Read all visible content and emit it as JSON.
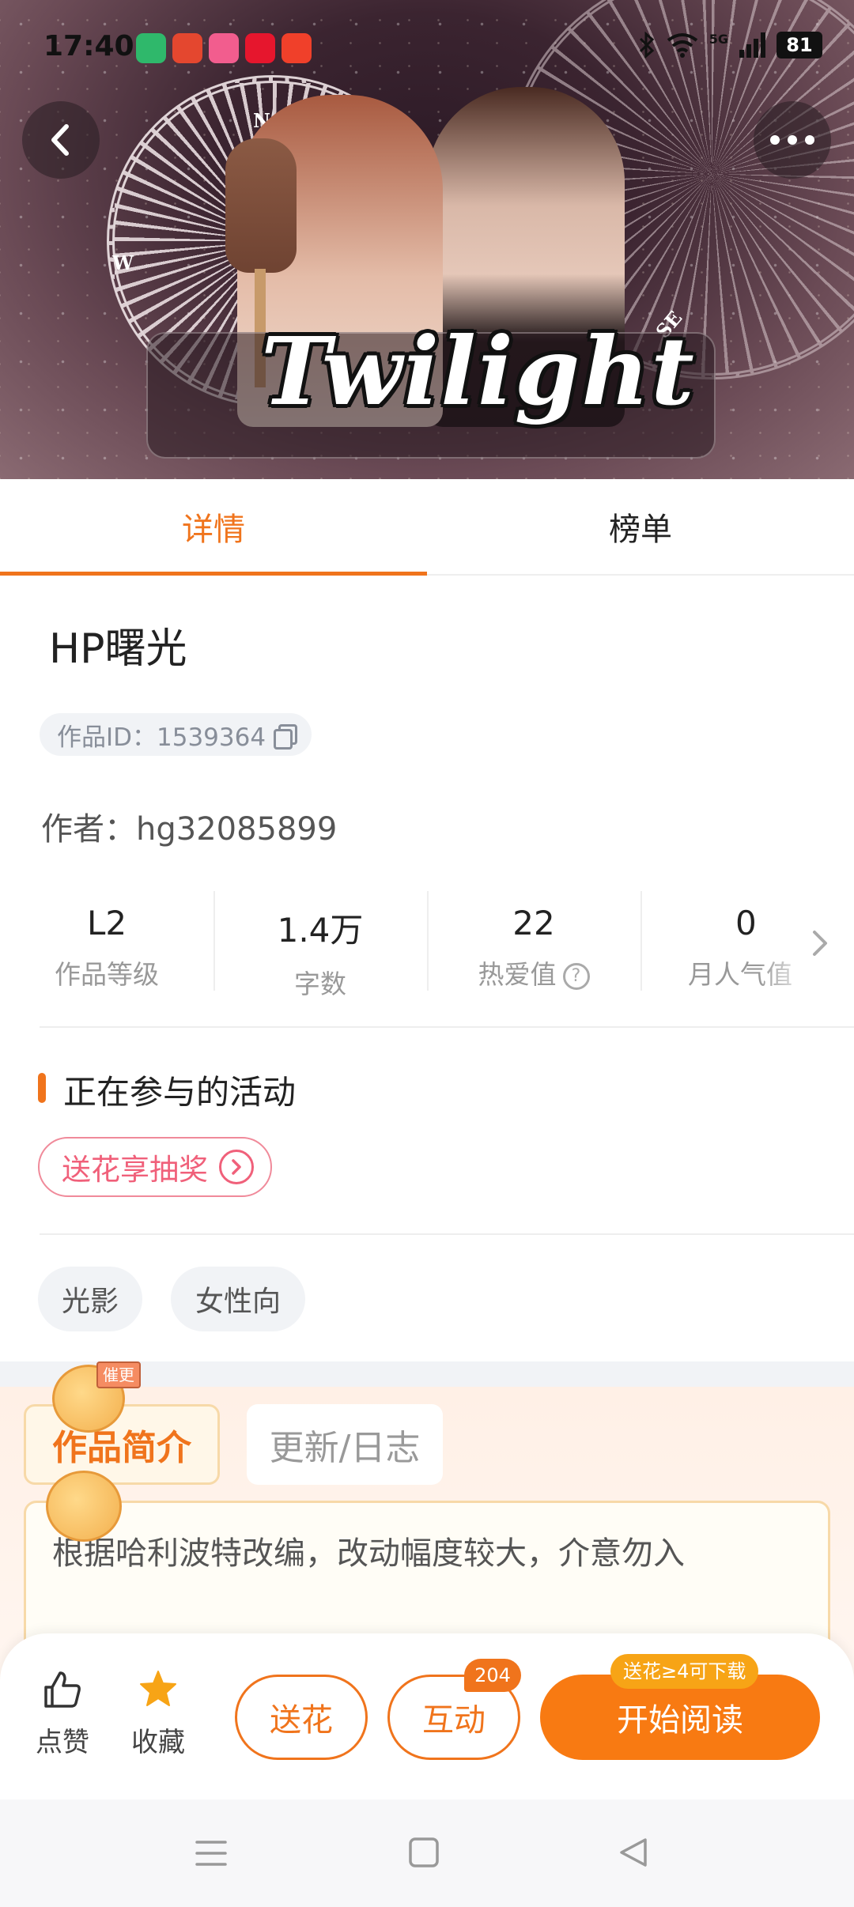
{
  "status_bar": {
    "time": "17:40",
    "network": "5G",
    "battery": "81",
    "app_icons": [
      "video-app-icon",
      "food-app-icon",
      "bilibili-icon",
      "weibo-icon",
      "video-play-icon"
    ],
    "app_colors": [
      "#2fb86b",
      "#e4472f",
      "#f25d8e",
      "#e6162d",
      "#f0402a"
    ]
  },
  "cover": {
    "title_art": "Twilight",
    "cardinals": [
      "N",
      "W",
      "S",
      "SE"
    ]
  },
  "tabs": [
    {
      "label": "详情",
      "active": true
    },
    {
      "label": "榜单",
      "active": false
    }
  ],
  "book": {
    "title": "HP曙光",
    "work_id": "作品ID：1539364",
    "author": "作者：hg32085899"
  },
  "stats": [
    {
      "value": "L2",
      "label": "作品等级"
    },
    {
      "value": "1.4万",
      "label": "字数"
    },
    {
      "value": "22",
      "label": "热爱值"
    },
    {
      "value": "0",
      "label": "月人气值"
    }
  ],
  "activities": {
    "section_title": "正在参与的活动",
    "items": [
      "送花享抽奖"
    ]
  },
  "tags": [
    "光影",
    "女性向"
  ],
  "intro": {
    "tabs": [
      "作品简介",
      "更新/日志"
    ],
    "mascot_sign": "催更",
    "text": "根据哈利波特改编，改动幅度较大，介意勿入"
  },
  "actions": {
    "like": "点赞",
    "favorite": "收藏",
    "flower": "送花",
    "interact": "互动",
    "interact_count": "204",
    "read": "开始阅读",
    "read_badge": "送花≥4可下载"
  },
  "theme": {
    "accent": "#f0741c",
    "favorite_star": "#f7a416",
    "activity_pink": "#f0607a"
  }
}
